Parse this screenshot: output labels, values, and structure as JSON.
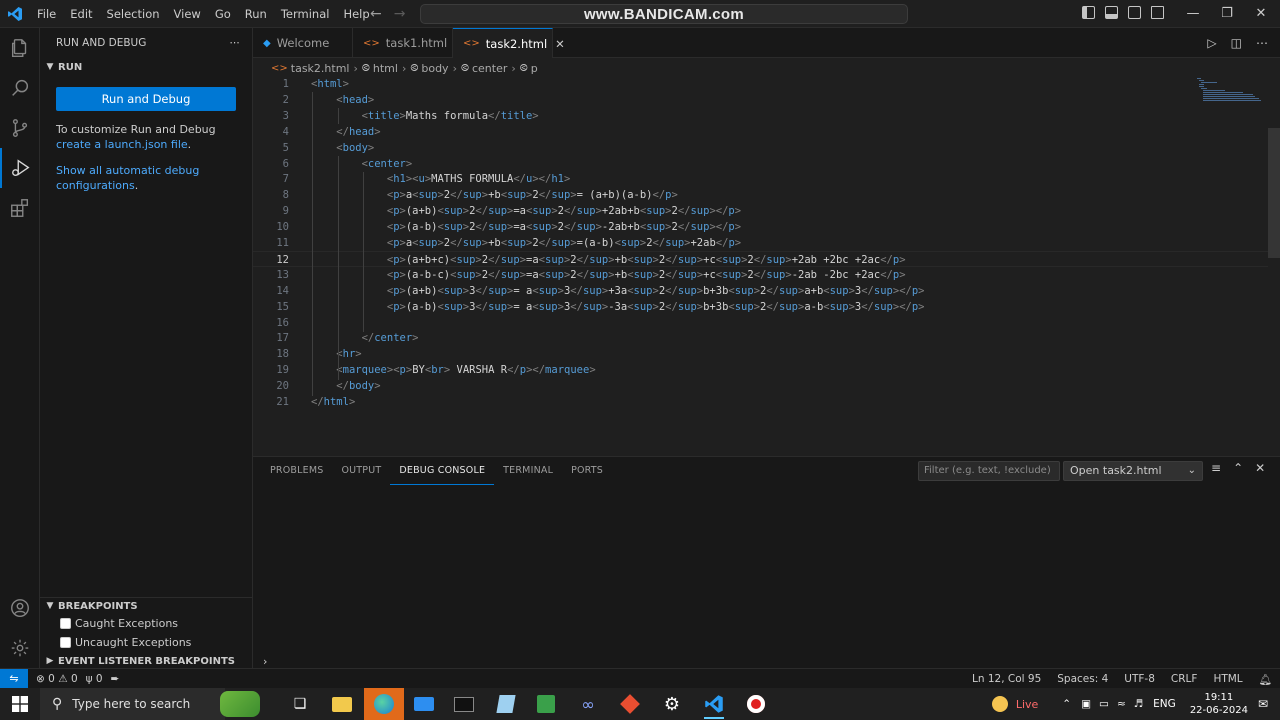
{
  "watermark": "www.BANDICAM.com",
  "menu": [
    "File",
    "Edit",
    "Selection",
    "View",
    "Go",
    "Run",
    "Terminal",
    "Help"
  ],
  "sidebar": {
    "title": "RUN AND DEBUG",
    "run_section": "RUN",
    "run_button": "Run and Debug",
    "customize_text": "To customize Run and Debug ",
    "customize_link": "create a launch.json file",
    "customize_end": ".",
    "show_all_link": "Show all automatic debug configurations",
    "show_all_end": ".",
    "breakpoints_title": "BREAKPOINTS",
    "breakpoints": [
      "Caught Exceptions",
      "Uncaught Exceptions"
    ],
    "event_listener": "EVENT LISTENER BREAKPOINTS"
  },
  "tabs": [
    {
      "label": "Welcome"
    },
    {
      "label": "task1.html"
    },
    {
      "label": "task2.html"
    }
  ],
  "breadcrumb": [
    "task2.html",
    "html",
    "body",
    "center",
    "p"
  ],
  "editor": {
    "current_line": 12,
    "lines": [
      "<html>",
      "    <head>",
      "        <title>Maths formula</title>",
      "    </head>",
      "    <body>",
      "        <center>",
      "            <h1><u>MATHS FORMULA</u></h1>",
      "            <p>a<sup>2</sup>+b<sup>2</sup>= (a+b)(a-b)</p>",
      "            <p>(a+b)<sup>2</sup>=a<sup>2</sup>+2ab+b<sup>2</sup></p>",
      "            <p>(a-b)<sup>2</sup>=a<sup>2</sup>-2ab+b<sup>2</sup></p>",
      "            <p>a<sup>2</sup>+b<sup>2</sup>=(a-b)<sup>2</sup>+2ab</p>",
      "            <p>(a+b+c)<sup>2</sup>=a<sup>2</sup>+b<sup>2</sup>+c<sup>2</sup>+2ab +2bc +2ac</p>",
      "            <p>(a-b-c)<sup>2</sup>=a<sup>2</sup>+b<sup>2</sup>+c<sup>2</sup>-2ab -2bc +2ac</p>",
      "            <p>(a+b)<sup>3</sup>= a<sup>3</sup>+3a<sup>2</sup>b+3b<sup>2</sup>a+b<sup>3</sup></p>",
      "            <p>(a-b)<sup>3</sup>= a<sup>3</sup>-3a<sup>2</sup>b+3b<sup>2</sup>a-b<sup>3</sup></p>",
      "",
      "        </center>",
      "    <hr>",
      "    <marquee><p>BY<br> VARSHA R</p></marquee>",
      "    </body>",
      "</html>"
    ]
  },
  "panel": {
    "tabs": [
      "PROBLEMS",
      "OUTPUT",
      "DEBUG CONSOLE",
      "TERMINAL",
      "PORTS"
    ],
    "active_tab": "DEBUG CONSOLE",
    "filter_placeholder": "Filter (e.g. text, !exclude)",
    "open_select": "Open task2.html"
  },
  "statusbar": {
    "errors": "0",
    "warnings": "0",
    "ports": "0",
    "position": "Ln 12, Col 95",
    "spaces": "Spaces: 4",
    "encoding": "UTF-8",
    "eol": "CRLF",
    "language": "HTML"
  },
  "taskbar": {
    "search_placeholder": "Type here to search",
    "live": "Live",
    "lang": "ENG",
    "time": "19:11",
    "date": "22-06-2024"
  },
  "colors": {
    "accent": "#0078d4",
    "tag": "#569cd6",
    "link": "#4daafc"
  }
}
